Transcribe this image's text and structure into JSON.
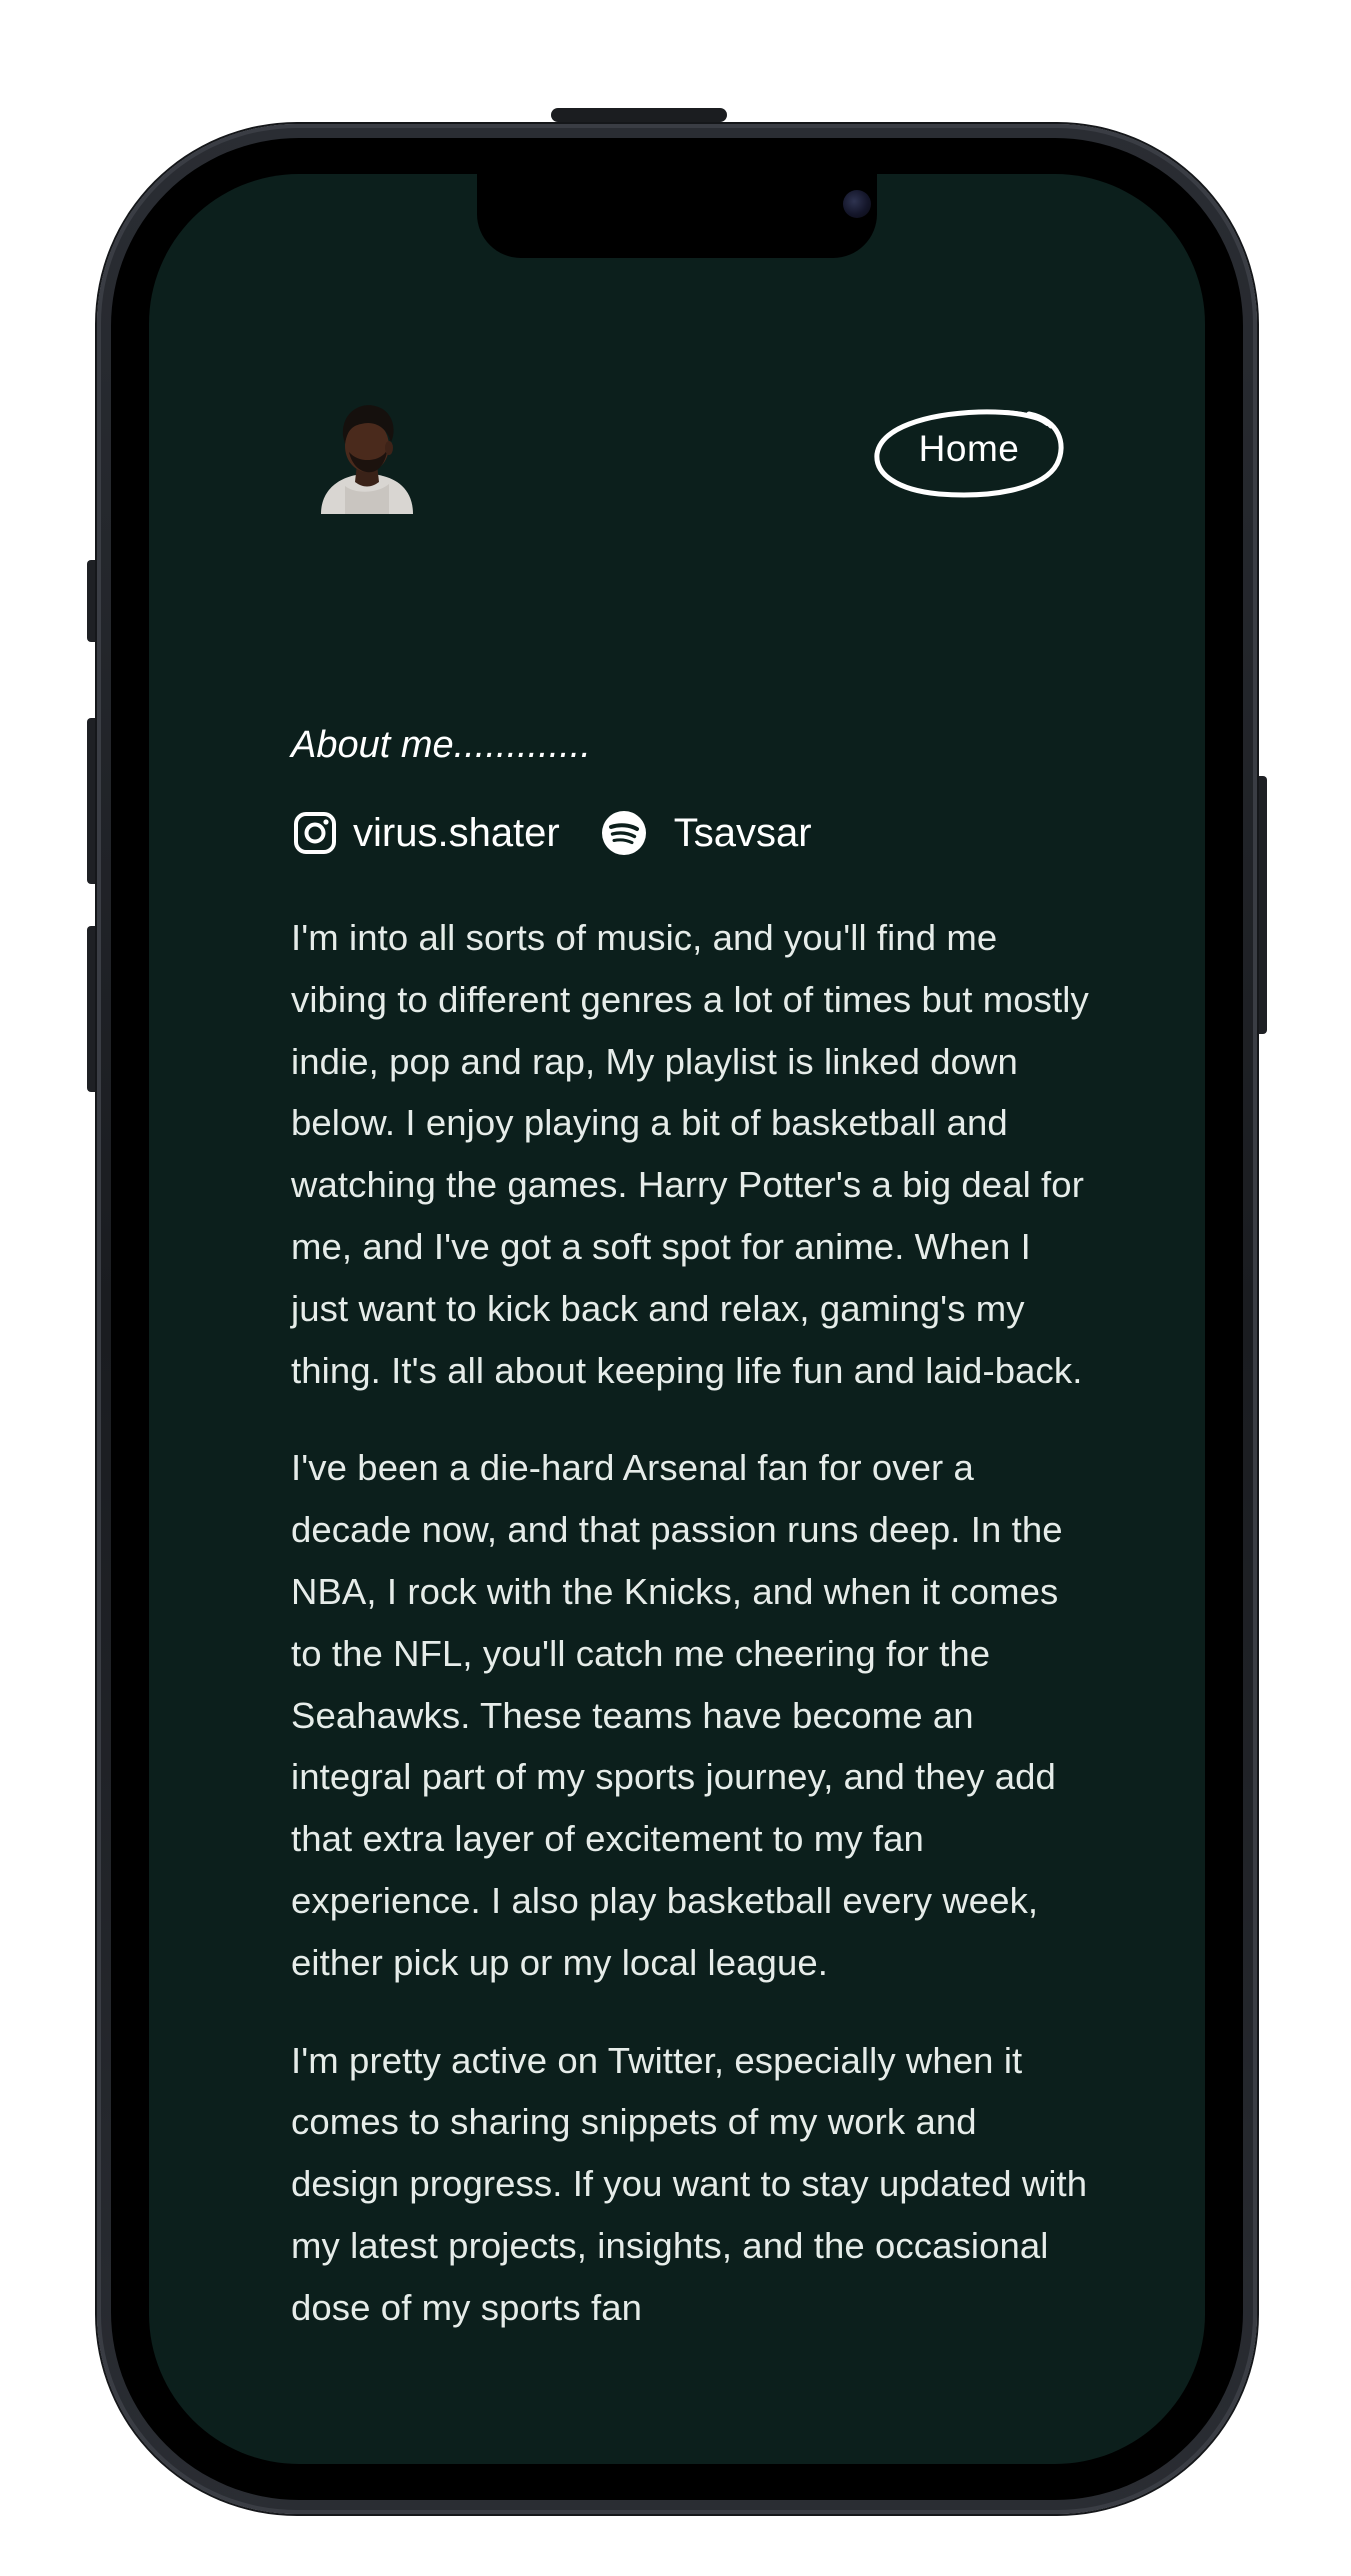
{
  "header": {
    "avatar_alt": "profile avatar",
    "nav_home_label": "Home"
  },
  "about": {
    "heading": "About me.............",
    "socials": [
      {
        "icon": "instagram-icon",
        "label": "virus.shater"
      },
      {
        "icon": "spotify-icon",
        "label": "Tsavsar"
      }
    ],
    "paragraphs": [
      "I'm into all sorts of music, and you'll find me vibing to different genres a lot of times but mostly indie, pop and rap, My playlist is linked down below. I enjoy playing a bit of basketball and watching the games. Harry Potter's a big deal for me, and I've got a soft spot for anime. When I just want to kick back and relax, gaming's my thing. It's all about keeping life fun and laid-back.",
      "I've been a die-hard Arsenal fan for over a decade now, and that passion runs deep. In the NBA, I rock with the Knicks, and when it comes to the NFL, you'll catch me cheering for the Seahawks. These teams have become an integral part of my sports journey, and they add that extra layer of excitement to my fan experience. I also play basketball every week, either pick up or my local league.",
      "I'm pretty active on Twitter, especially when it comes to sharing snippets of my work and design progress. If you want to stay updated with my latest projects, insights, and the occasional dose of my sports fan"
    ]
  },
  "colors": {
    "screen_background": "#0c1f1c",
    "text": "#e6ece9",
    "heading": "#ffffff",
    "frame": "#1a1c20"
  }
}
